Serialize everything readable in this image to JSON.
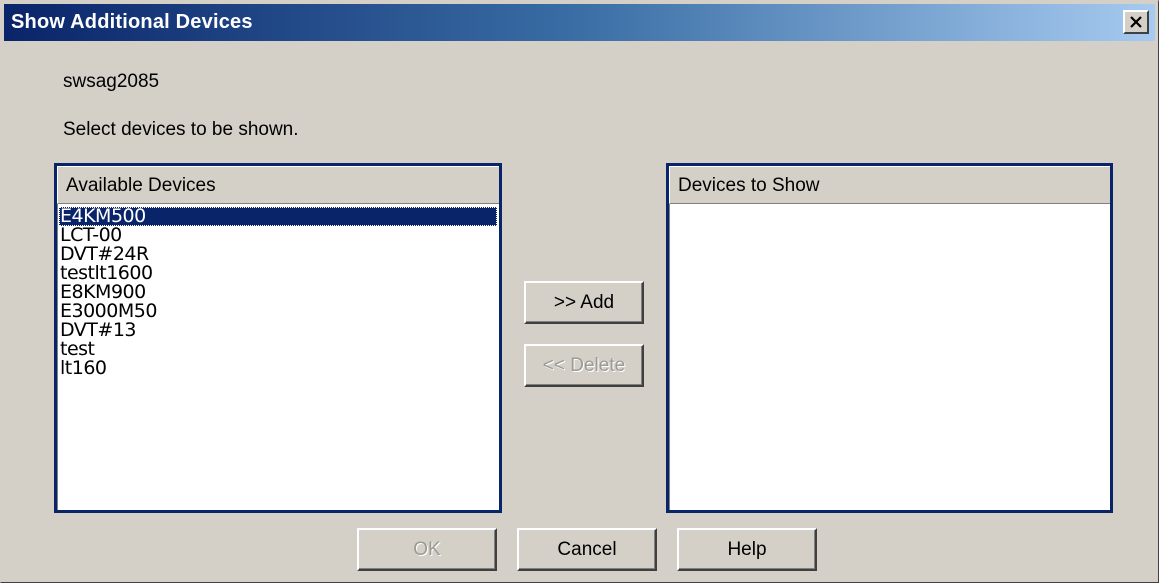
{
  "window": {
    "title": "Show Additional Devices",
    "close_label": "×"
  },
  "host_name": "swsag2085",
  "instruction": "Select devices to be shown.",
  "available_devices": {
    "header": "Available Devices",
    "items": [
      {
        "label": "E4KM500",
        "selected": true
      },
      {
        "label": "LCT-00",
        "selected": false
      },
      {
        "label": "DVT#24R",
        "selected": false
      },
      {
        "label": " testlt1600",
        "selected": false
      },
      {
        "label": "E8KM900",
        "selected": false
      },
      {
        "label": "E3000M50",
        "selected": false
      },
      {
        "label": "DVT#13",
        "selected": false
      },
      {
        "label": "test",
        "selected": false
      },
      {
        "label": "lt160",
        "selected": false
      }
    ]
  },
  "devices_to_show": {
    "header": "Devices to Show",
    "items": []
  },
  "buttons": {
    "add": {
      "label": ">> Add",
      "enabled": true
    },
    "delete": {
      "label": "<< Delete",
      "enabled": false
    },
    "ok": {
      "label": "OK",
      "enabled": false
    },
    "cancel": {
      "label": "Cancel",
      "enabled": true
    },
    "help": {
      "label": "Help",
      "enabled": true
    }
  },
  "colors": {
    "titlebar_start": "#0a246a",
    "titlebar_end": "#a6caf0",
    "dialog_bg": "#d4d0c8",
    "selection": "#0a246a",
    "disabled_text": "#9c9a94"
  }
}
